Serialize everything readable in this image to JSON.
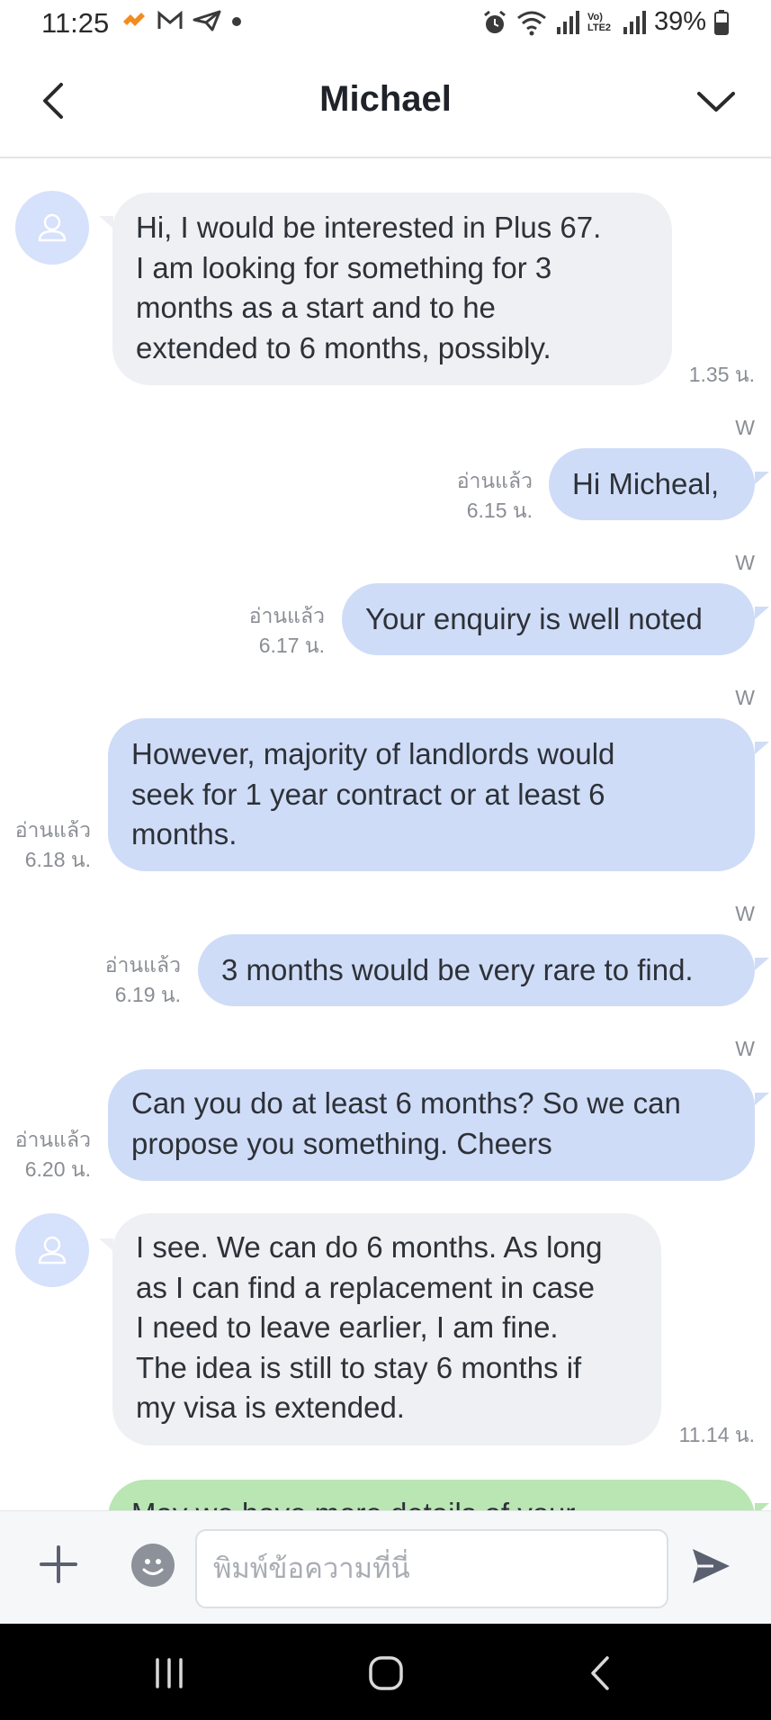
{
  "status_bar": {
    "time": "11:25",
    "battery": "39%",
    "volte_label": "Vo) LTE2"
  },
  "header": {
    "title": "Michael"
  },
  "messages": [
    {
      "direction": "incoming",
      "lines": [
        "Hi, I would be interested in Plus 67.",
        "I am looking for something for 3",
        "months as a start and to he",
        "extended to 6 months, possibly."
      ],
      "time": "1.35 น."
    },
    {
      "direction": "outgoing",
      "sender": "W",
      "lines": [
        "Hi Micheal,"
      ],
      "read": "อ่านแล้ว",
      "time": "6.15 น."
    },
    {
      "direction": "outgoing",
      "sender": "W",
      "lines": [
        "Your enquiry is well noted"
      ],
      "read": "อ่านแล้ว",
      "time": "6.17 น."
    },
    {
      "direction": "outgoing",
      "sender": "W",
      "lines": [
        "However, majority of landlords would",
        "seek for 1 year contract or at least 6",
        "months."
      ],
      "read": "อ่านแล้ว",
      "time": "6.18 น."
    },
    {
      "direction": "outgoing",
      "sender": "W",
      "lines": [
        "3 months would be very rare to find."
      ],
      "read": "อ่านแล้ว",
      "time": "6.19 น."
    },
    {
      "direction": "outgoing",
      "sender": "W",
      "lines": [
        "Can you do at least 6 months? So we can",
        "propose you something. Cheers"
      ],
      "read": "อ่านแล้ว",
      "time": "6.20 น."
    },
    {
      "direction": "incoming",
      "lines": [
        "I see. We can do 6 months. As long",
        "as I can find a replacement in case",
        "I need to leave earlier, I am fine.",
        "The idea is still to stay 6 months if",
        "my visa is extended."
      ],
      "time": "11.14 น."
    },
    {
      "direction": "outgoing",
      "lines": [
        "May we have more details of your"
      ]
    }
  ],
  "input_bar": {
    "placeholder": "พิมพ์ข้อความที่นี่"
  },
  "colors": {
    "incoming_bubble": "#eef0f3",
    "outgoing_bubble": "#cfdcf7",
    "partial_bubble": "#b9e6b3",
    "avatar_bg": "#d6e1fb"
  }
}
